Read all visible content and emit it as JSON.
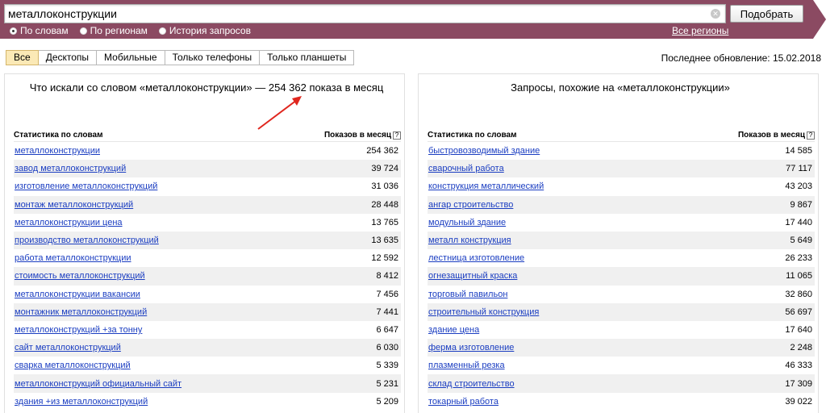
{
  "search": {
    "value": "металлоконструкции",
    "submit_label": "Подобрать"
  },
  "modes": [
    {
      "label": "По словам",
      "selected": true
    },
    {
      "label": "По регионам",
      "selected": false
    },
    {
      "label": "История запросов",
      "selected": false
    }
  ],
  "regions_link": "Все регионы",
  "device_tabs": [
    "Все",
    "Десктопы",
    "Мобильные",
    "Только телефоны",
    "Только планшеты"
  ],
  "last_update": "Последнее обновление: 15.02.2018",
  "left_panel": {
    "title": "Что искали со словом «металлоконструкции» — 254 362 показа в месяц",
    "col_query": "Статистика по словам",
    "col_count": "Показов в месяц",
    "rows": [
      {
        "q": "металлоконструкции",
        "n": "254 362"
      },
      {
        "q": "завод металлоконструкций",
        "n": "39 724"
      },
      {
        "q": "изготовление металлоконструкций",
        "n": "31 036"
      },
      {
        "q": "монтаж металлоконструкций",
        "n": "28 448"
      },
      {
        "q": "металлоконструкции цена",
        "n": "13 765"
      },
      {
        "q": "производство металлоконструкций",
        "n": "13 635"
      },
      {
        "q": "работа металлоконструкции",
        "n": "12 592"
      },
      {
        "q": "стоимость металлоконструкций",
        "n": "8 412"
      },
      {
        "q": "металлоконструкции вакансии",
        "n": "7 456"
      },
      {
        "q": "монтажник металлоконструкций",
        "n": "7 441"
      },
      {
        "q": "металлоконструкций +за тонну",
        "n": "6 647"
      },
      {
        "q": "сайт металлоконструкций",
        "n": "6 030"
      },
      {
        "q": "сварка металлоконструкций",
        "n": "5 339"
      },
      {
        "q": "металлоконструкций официальный сайт",
        "n": "5 231"
      },
      {
        "q": "здания +из металлоконструкций",
        "n": "5 209"
      }
    ]
  },
  "right_panel": {
    "title": "Запросы, похожие на «металлоконструкции»",
    "col_query": "Статистика по словам",
    "col_count": "Показов в месяц",
    "rows": [
      {
        "q": "быстровозводимый здание",
        "n": "14 585"
      },
      {
        "q": "сварочный работа",
        "n": "77 117"
      },
      {
        "q": "конструкция металлический",
        "n": "43 203"
      },
      {
        "q": "ангар строительство",
        "n": "9 867"
      },
      {
        "q": "модульный здание",
        "n": "17 440"
      },
      {
        "q": "металл конструкция",
        "n": "5 649"
      },
      {
        "q": "лестница изготовление",
        "n": "26 233"
      },
      {
        "q": "огнезащитный краска",
        "n": "11 065"
      },
      {
        "q": "торговый павильон",
        "n": "32 860"
      },
      {
        "q": "строительный конструкция",
        "n": "56 697"
      },
      {
        "q": "здание цена",
        "n": "17 640"
      },
      {
        "q": "ферма изготовление",
        "n": "2 248"
      },
      {
        "q": "плазменный резка",
        "n": "46 333"
      },
      {
        "q": "склад строительство",
        "n": "17 309"
      },
      {
        "q": "токарный работа",
        "n": "39 022"
      }
    ]
  },
  "colors": {
    "topbar": "#8b4a62",
    "link": "#1a3dc1",
    "active_tab": "#fbe9b6",
    "annotation_arrow": "#e0261e"
  }
}
